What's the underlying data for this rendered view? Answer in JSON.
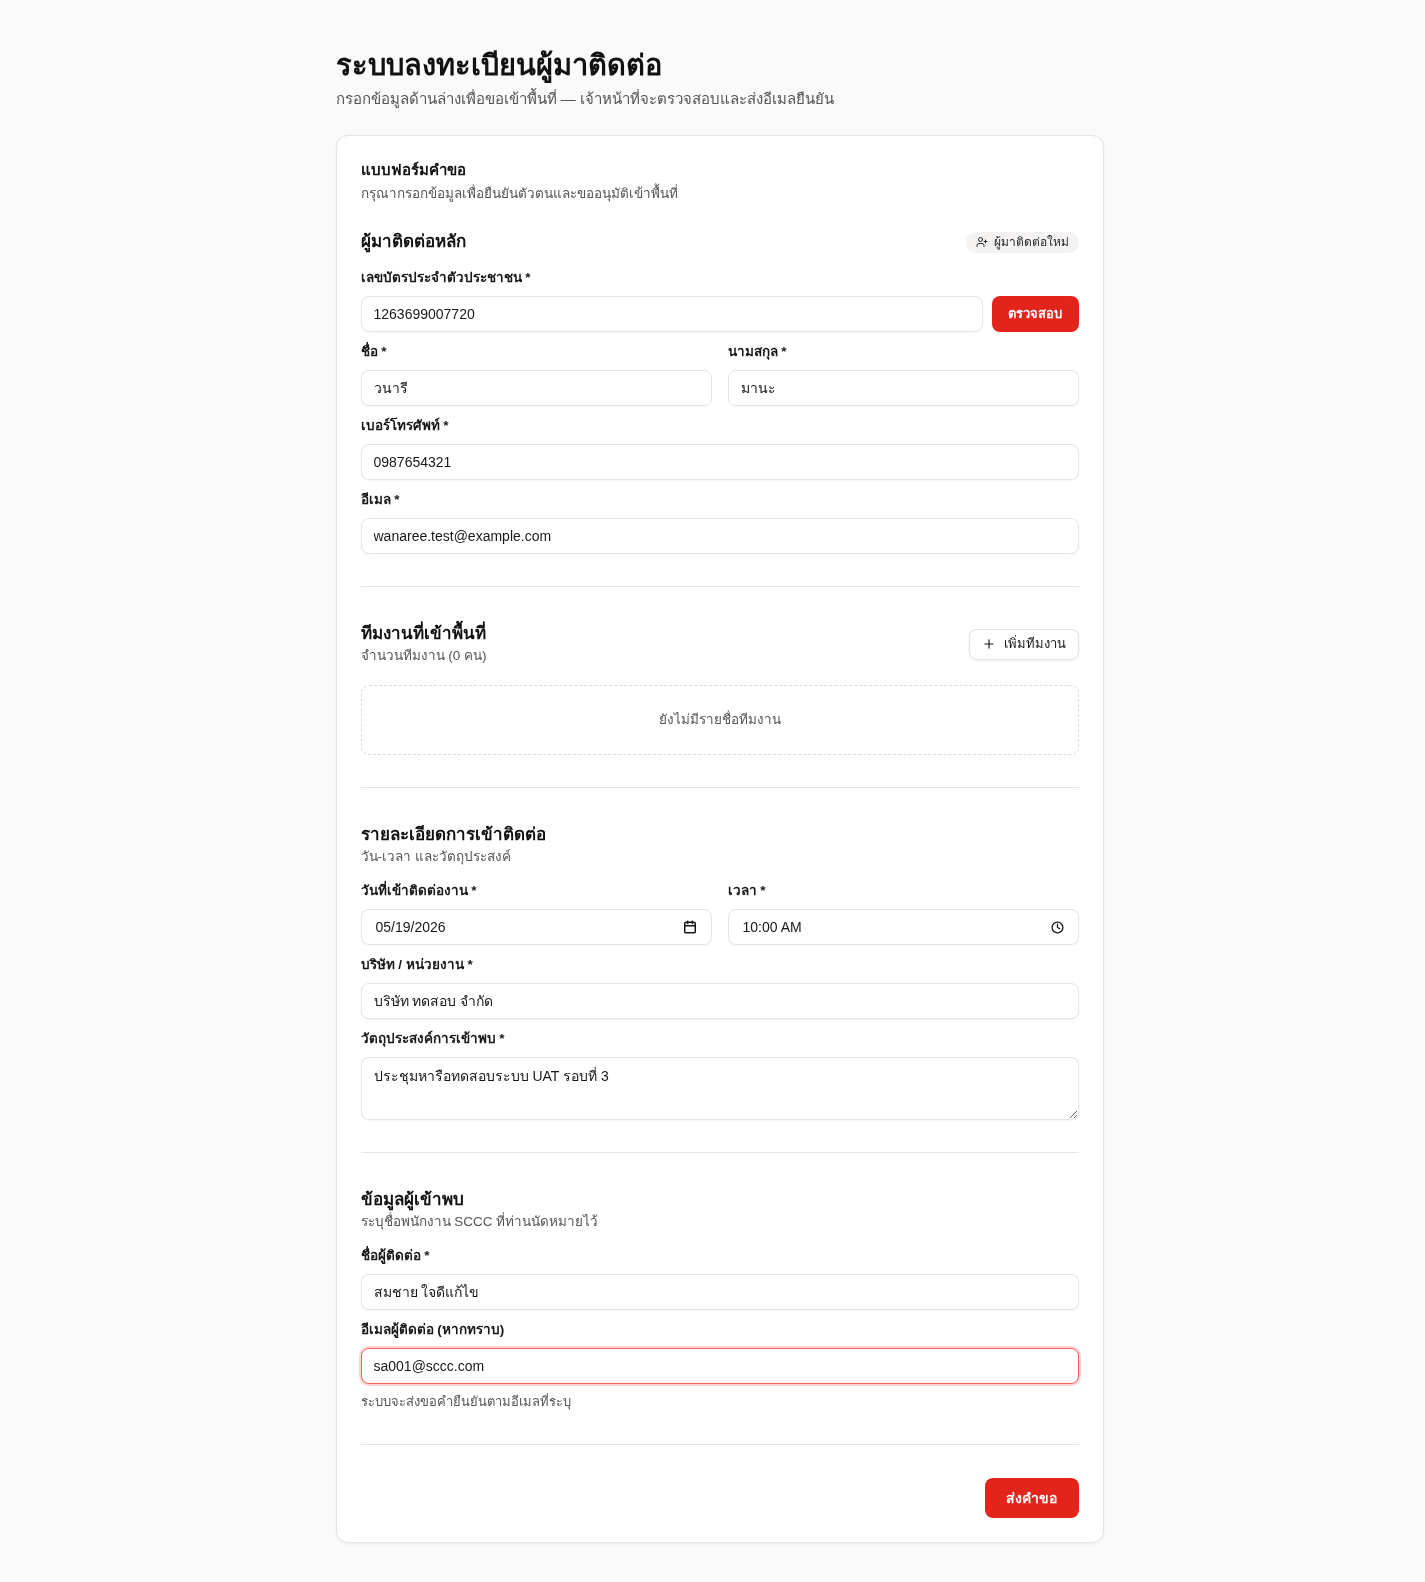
{
  "header": {
    "title": "ระบบลงทะเบียนผู้มาติดต่อ",
    "subtitle": "กรอกข้อมูลด้านล่างเพื่อขอเข้าพื้นที่ — เจ้าหน้าที่จะตรวจสอบและส่งอีเมลยืนยัน"
  },
  "form": {
    "title": "แบบฟอร์มคำขอ",
    "description": "กรุณากรอกข้อมูลเพื่อยืนยันตัวตนและขออนุมัติเข้าพื้นที่"
  },
  "sections": [
    {
      "kind": "fields",
      "title": "ผู้มาติดต่อหลัก",
      "badge": "ผู้มาติดต่อใหม่",
      "rows": [
        [
          {
            "kind": "text_with_button",
            "label": "เลขบัตรประจำตัวประชาชน *",
            "value": "1263699007720",
            "button": "ตรวจสอบ",
            "focused": false
          }
        ],
        [
          {
            "kind": "text",
            "label": "ชื่อ *",
            "value": "วนารี",
            "focused": false
          },
          {
            "kind": "text",
            "label": "นามสกุล *",
            "value": "มานะ",
            "focused": false
          }
        ],
        [
          {
            "kind": "text",
            "label": "เบอร์โทรศัพท์ *",
            "value": "0987654321",
            "focused": false
          }
        ],
        [
          {
            "kind": "text",
            "label": "อีเมล *",
            "value": "wanaree.test@example.com",
            "focused": false
          }
        ]
      ]
    },
    {
      "kind": "team",
      "title": "ทีมงานที่เข้าพื้นที่",
      "subtitle": "จำนวนทีมงาน (0 คน)",
      "add_button": "เพิ่มทีมงาน",
      "empty_message": "ยังไม่มีรายชื่อทีมงาน"
    },
    {
      "kind": "fields",
      "title": "รายละเอียดการเข้าติดต่อ",
      "subtitle": "วัน-เวลา และวัตถุประสงค์",
      "rows": [
        [
          {
            "kind": "date",
            "label": "วันที่เข้าติดต่องาน *",
            "value": "05/19/2026",
            "focused": false
          },
          {
            "kind": "time",
            "label": "เวลา *",
            "value": "10:00 AM",
            "focused": false
          }
        ],
        [
          {
            "kind": "text",
            "label": "บริษัท / หน่วยงาน *",
            "value": "บริษัท ทดสอบ จำกัด",
            "focused": false
          }
        ],
        [
          {
            "kind": "textarea",
            "label": "วัตถุประสงค์การเข้าพบ *",
            "value": "ประชุมหารือทดสอบระบบ UAT รอบที่ 3",
            "focused": false
          }
        ]
      ]
    },
    {
      "kind": "fields",
      "title": "ข้อมูลผู้เข้าพบ",
      "subtitle": "ระบุชื่อพนักงาน SCCC ที่ท่านนัดหมายไว้",
      "rows": [
        [
          {
            "kind": "text",
            "label": "ชื่อผู้ติดต่อ *",
            "value": "สมชาย ใจดีแก้ไข",
            "focused": false
          }
        ],
        [
          {
            "kind": "text",
            "label": "อีเมลผู้ติดต่อ (หากทราบ)",
            "value": "sa001@sccc.com",
            "focused": true,
            "hint": "ระบบจะส่งขอคำยืนยันตามอีเมลที่ระบุ"
          }
        ]
      ]
    }
  ],
  "submit_button": "ส่งคำขอ"
}
